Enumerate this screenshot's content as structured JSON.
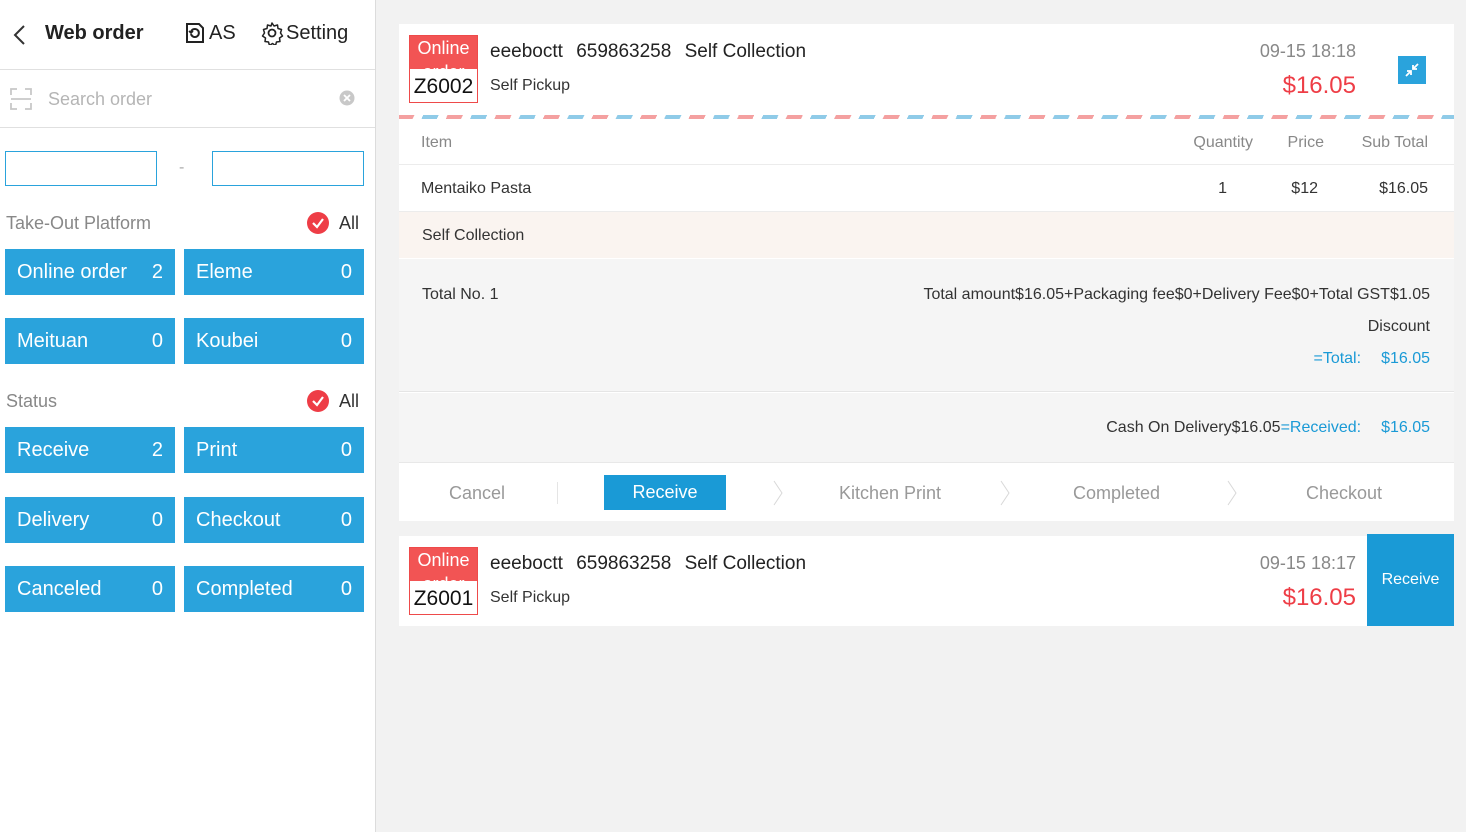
{
  "header": {
    "title": "Web order",
    "as_label": "AS",
    "setting_label": "Setting"
  },
  "search": {
    "placeholder": "Search order",
    "value": ""
  },
  "date_range": {
    "start": "",
    "end": "",
    "separator": "-"
  },
  "platform_section": {
    "label": "Take-Out Platform",
    "all_label": "All",
    "tiles": [
      {
        "label": "Online order",
        "count": "2"
      },
      {
        "label": "Eleme",
        "count": "0"
      },
      {
        "label": "Meituan",
        "count": "0"
      },
      {
        "label": "Koubei",
        "count": "0"
      }
    ]
  },
  "status_section": {
    "label": "Status",
    "all_label": "All",
    "tiles": [
      {
        "label": "Receive",
        "count": "2"
      },
      {
        "label": "Print",
        "count": "0"
      },
      {
        "label": "Delivery",
        "count": "0"
      },
      {
        "label": "Checkout",
        "count": "0"
      },
      {
        "label": "Canceled",
        "count": "0"
      },
      {
        "label": "Completed",
        "count": "0"
      }
    ]
  },
  "orders": [
    {
      "badge_type": "Online order",
      "order_no": "Z6002",
      "customer": "eeeboctt",
      "phone": "659863258",
      "mode": "Self Collection",
      "pickup": "Self Pickup",
      "time": "09-15 18:18",
      "price": "$16.05",
      "table_headers": {
        "item": "Item",
        "qty": "Quantity",
        "price": "Price",
        "sub": "Sub Total"
      },
      "items": [
        {
          "name": "Mentaiko Pasta",
          "qty": "1",
          "price": "$12",
          "sub": "$16.05"
        }
      ],
      "note": "Self Collection",
      "total_no": "Total No. 1",
      "amount_line": "Total amount$16.05+Packaging fee$0+Delivery Fee$0+Total GST$1.05",
      "discount_label": "Discount",
      "total_label": "=Total:",
      "total_value": "$16.05",
      "payment_text": "Cash On Delivery$16.05",
      "received_label": "=Received:",
      "received_value": "$16.05",
      "steps": {
        "cancel": "Cancel",
        "receive": "Receive",
        "kitchen_print": "Kitchen Print",
        "completed": "Completed",
        "checkout": "Checkout"
      }
    },
    {
      "badge_type": "Online order",
      "order_no": "Z6001",
      "customer": "eeeboctt",
      "phone": "659863258",
      "mode": "Self Collection",
      "pickup": "Self Pickup",
      "time": "09-15 18:17",
      "price": "$16.05",
      "action_label": "Receive"
    }
  ],
  "colors": {
    "accent_blue": "#2aa3dc",
    "button_blue": "#1a9ad6",
    "price_red": "#ee3d46",
    "badge_red": "#f25454"
  }
}
